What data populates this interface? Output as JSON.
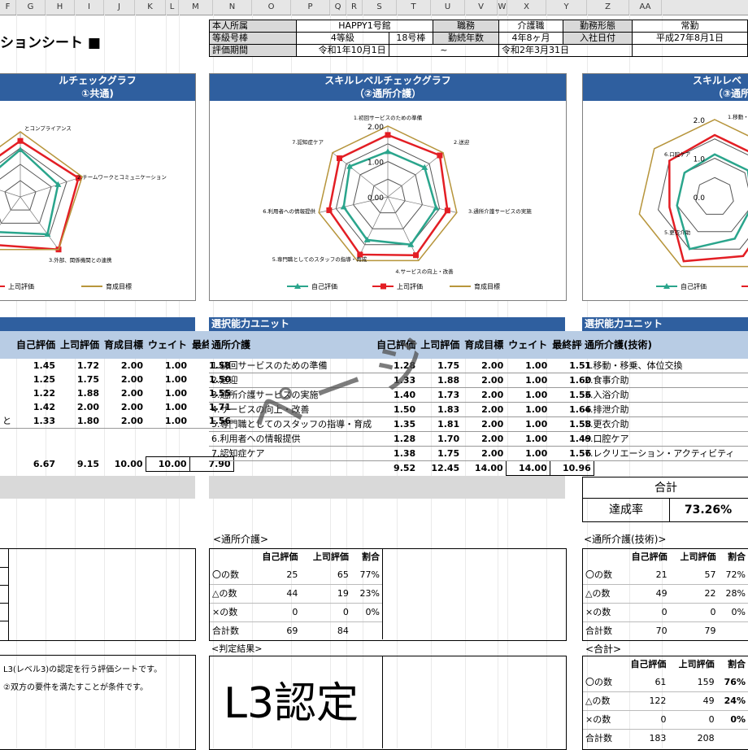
{
  "columns": [
    "F",
    "G",
    "H",
    "I",
    "J",
    "K",
    "L",
    "M",
    "N",
    "O",
    "P",
    "Q",
    "R",
    "S",
    "T",
    "U",
    "V",
    "W",
    "X",
    "Y",
    "Z",
    "AA"
  ],
  "sheet_title": "ションシート ■",
  "info": {
    "dept_label": "本人所属",
    "dept_value": "HAPPY1号館",
    "job_label": "職務",
    "job_value": "介護職",
    "work_type_label": "勤務形態",
    "work_type_value": "常勤",
    "grade_label": "等級号棒",
    "grade_value": "4等級",
    "grade_no": "18号棒",
    "tenure_label": "勤続年数",
    "tenure_value": "4年8ヶ月",
    "join_label": "入社日付",
    "join_value": "平成27年8月1日",
    "period_label": "評価期間",
    "period_from": "令和1年10月1日",
    "period_sep": "~",
    "period_to": "令和2年3月31日"
  },
  "charts": [
    {
      "title": "ルチェックグラフ",
      "subtitle": "①共通)",
      "axes": [
        "とコンプライアンス",
        "2.チームワークとコミュニケーション",
        "3.外部、関係機関との連携"
      ],
      "legend_self": "",
      "legend_boss": "上司評価",
      "legend_target": "育成目標"
    },
    {
      "title": "スキルレベルチェックグラフ",
      "subtitle": "（②通所介護）",
      "axes": [
        "1.初回サービスのための準備",
        "2.送迎",
        "3.通所介護サービスの実施",
        "4.サービスの向上・改善",
        "5.専門職としてのスタッフの指導・育成",
        "6.利用者への情報提供",
        "7.認知症ケア"
      ],
      "ticks": [
        "2.00",
        "1.00",
        "0.00"
      ],
      "legend_self": "自己評価",
      "legend_boss": "上司評価",
      "legend_target": "育成目標"
    },
    {
      "title": "スキルレベ",
      "subtitle": "（③通所",
      "axes": [
        "1.移動・移",
        "6.口腔ケア",
        "5.更衣介助"
      ],
      "ticks": [
        "2.0",
        "1.0",
        "0.0"
      ],
      "legend_self": "自己評価",
      "legend_boss": ""
    }
  ],
  "chart_data": [
    {
      "type": "radar",
      "title": "スキルレベルチェックグラフ（②通所介護）",
      "categories": [
        "1.初回サービスのための準備",
        "2.送迎",
        "3.通所介護サービスの実施",
        "4.サービスの向上・改善",
        "5.専門職としてのスタッフの指導・育成",
        "6.利用者への情報提供",
        "7.認知症ケア"
      ],
      "ylim": [
        0,
        2
      ],
      "series": [
        {
          "name": "自己評価",
          "values": [
            1.28,
            1.33,
            1.4,
            1.5,
            1.35,
            1.28,
            1.38
          ],
          "color": "#2aa58c"
        },
        {
          "name": "上司評価",
          "values": [
            1.75,
            1.88,
            1.73,
            1.83,
            1.81,
            1.7,
            1.75
          ],
          "color": "#e31e24"
        },
        {
          "name": "育成目標",
          "values": [
            2.0,
            2.0,
            2.0,
            2.0,
            2.0,
            2.0,
            2.0
          ],
          "color": "#b8963c"
        }
      ]
    },
    {
      "type": "radar",
      "title": "①共通",
      "categories": [
        "1",
        "2",
        "3",
        "4",
        "5"
      ],
      "ylim": [
        0,
        2
      ],
      "series": [
        {
          "name": "自己評価",
          "values": [
            1.45,
            1.22,
            1.42,
            1.33,
            1.3
          ],
          "color": "#2aa58c"
        },
        {
          "name": "上司評価",
          "values": [
            1.72,
            1.88,
            2.0,
            1.8,
            1.75
          ],
          "color": "#e31e24"
        },
        {
          "name": "育成目標",
          "values": [
            2.0,
            2.0,
            2.0,
            2.0,
            2.0
          ],
          "color": "#b8963c"
        }
      ]
    }
  ],
  "left_table": {
    "headers": [
      "自己評価",
      "上司評価",
      "育成目標",
      "ウェイト",
      "最終評価"
    ],
    "rows": [
      [
        "1.45",
        "1.72",
        "2.00",
        "1.00",
        "1.58"
      ],
      [
        "1.25",
        "1.75",
        "2.00",
        "1.00",
        "1.50"
      ],
      [
        "1.22",
        "1.88",
        "2.00",
        "1.00",
        "1.55"
      ],
      [
        "1.42",
        "2.00",
        "2.00",
        "1.00",
        "1.71"
      ],
      [
        "1.33",
        "1.80",
        "2.00",
        "1.00",
        "1.56"
      ]
    ],
    "row5_tail": "と",
    "total": [
      "6.67",
      "9.15",
      "10.00",
      "10.00",
      "7.90"
    ]
  },
  "mid_table": {
    "section": "選択能力ユニット",
    "title": "通所介護",
    "headers": [
      "自己評価",
      "上司評価",
      "育成目標",
      "ウェイト",
      "最終評価"
    ],
    "rows": [
      [
        "1.初回サービスのための準備",
        "1.28",
        "1.75",
        "2.00",
        "1.00",
        "1.51"
      ],
      [
        "2.送迎",
        "1.33",
        "1.88",
        "2.00",
        "1.00",
        "1.60"
      ],
      [
        "3.通所介護サービスの実施",
        "1.40",
        "1.73",
        "2.00",
        "1.00",
        "1.56"
      ],
      [
        "4.サービスの向上・改善",
        "1.50",
        "1.83",
        "2.00",
        "1.00",
        "1.66"
      ],
      [
        "5.専門職としてのスタッフの指導・育成",
        "1.35",
        "1.81",
        "2.00",
        "1.00",
        "1.58"
      ],
      [
        "6.利用者への情報提供",
        "1.28",
        "1.70",
        "2.00",
        "1.00",
        "1.49"
      ],
      [
        "7.認知症ケア",
        "1.38",
        "1.75",
        "2.00",
        "1.00",
        "1.56"
      ]
    ],
    "total": [
      "9.52",
      "12.45",
      "14.00",
      "14.00",
      "10.96"
    ]
  },
  "right_table": {
    "section": "選択能力ユニット",
    "title": "通所介護(技術)",
    "rows": [
      "1.移動・移乗、体位交換",
      "2.食事介助",
      "3.入浴介助",
      "4.排泄介助",
      "5.更衣介助",
      "6.口腔ケア",
      "7.レクリエーション・アクティビティ"
    ],
    "total_label": "合計",
    "rate_label": "達成率",
    "rate_value": "73.26%"
  },
  "watermark": "ページ",
  "count_mid": {
    "caption": "<通所介護>",
    "headers": [
      "自己評価",
      "上司評価",
      "割合"
    ],
    "rows": [
      [
        "〇の数",
        "25",
        "65",
        "77%"
      ],
      [
        "△の数",
        "44",
        "19",
        "23%"
      ],
      [
        "×の数",
        "0",
        "0",
        "0%"
      ]
    ],
    "total": [
      "合計数",
      "69",
      "84"
    ]
  },
  "count_right": {
    "caption": "<通所介護(技術)>",
    "headers": [
      "自己評価",
      "上司評価",
      "割合"
    ],
    "rows": [
      [
        "〇の数",
        "21",
        "57",
        "72%"
      ],
      [
        "△の数",
        "49",
        "22",
        "28%"
      ],
      [
        "×の数",
        "0",
        "0",
        "0%"
      ]
    ],
    "total": [
      "合計数",
      "70",
      "79"
    ]
  },
  "count_total": {
    "caption": "<合計>",
    "headers": [
      "自己評価",
      "上司評価",
      "割合"
    ],
    "rows": [
      [
        "〇の数",
        "61",
        "159",
        "76%"
      ],
      [
        "△の数",
        "122",
        "49",
        "24%"
      ],
      [
        "×の数",
        "0",
        "0",
        "0%"
      ]
    ],
    "total": [
      "合計数",
      "183",
      "208"
    ]
  },
  "judgment": {
    "caption": "<判定結果>",
    "value": "L3認定"
  },
  "notes": [
    "L3(レベル3)の認定を行う評価シートです。",
    "②双方の要件を満たすことが条件です。"
  ]
}
